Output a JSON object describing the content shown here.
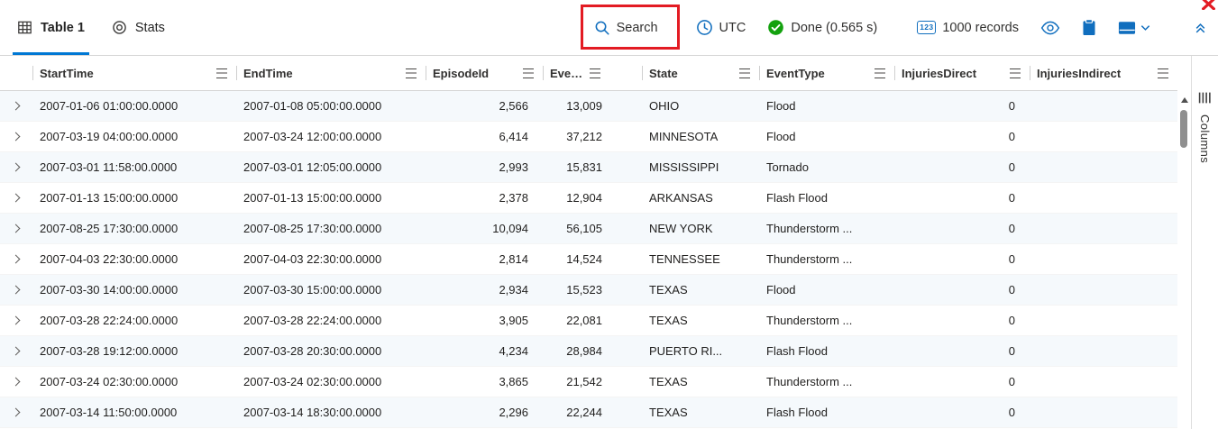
{
  "colors": {
    "accent": "#0078d4",
    "success_green": "#13a10e",
    "annotation_red": "#e31b23"
  },
  "tabs": {
    "table": "Table 1",
    "stats": "Stats"
  },
  "toolbar": {
    "search_label": "Search",
    "timezone_label": "UTC",
    "status_label": "Done (0.565 s)",
    "records_label": "1000 records",
    "numeric_badge_text": "123"
  },
  "columns_panel": {
    "title": "Columns"
  },
  "grid": {
    "columns": [
      {
        "label": "StartTime",
        "numeric": false
      },
      {
        "label": "EndTime",
        "numeric": false
      },
      {
        "label": "EpisodeId",
        "numeric": true
      },
      {
        "label": "EventId",
        "numeric": true
      },
      {
        "label": "State",
        "numeric": false
      },
      {
        "label": "EventType",
        "numeric": false
      },
      {
        "label": "InjuriesDirect",
        "numeric": true
      },
      {
        "label": "InjuriesIndirect",
        "numeric": true
      }
    ],
    "rows": [
      [
        "2007-01-06 01:00:00.0000",
        "2007-01-08 05:00:00.0000",
        "2,566",
        "13,009",
        "OHIO",
        "Flood",
        "0",
        ""
      ],
      [
        "2007-03-19 04:00:00.0000",
        "2007-03-24 12:00:00.0000",
        "6,414",
        "37,212",
        "MINNESOTA",
        "Flood",
        "0",
        ""
      ],
      [
        "2007-03-01 11:58:00.0000",
        "2007-03-01 12:05:00.0000",
        "2,993",
        "15,831",
        "MISSISSIPPI",
        "Tornado",
        "0",
        ""
      ],
      [
        "2007-01-13 15:00:00.0000",
        "2007-01-13 15:00:00.0000",
        "2,378",
        "12,904",
        "ARKANSAS",
        "Flash Flood",
        "0",
        ""
      ],
      [
        "2007-08-25 17:30:00.0000",
        "2007-08-25 17:30:00.0000",
        "10,094",
        "56,105",
        "NEW YORK",
        "Thunderstorm ...",
        "0",
        ""
      ],
      [
        "2007-04-03 22:30:00.0000",
        "2007-04-03 22:30:00.0000",
        "2,814",
        "14,524",
        "TENNESSEE",
        "Thunderstorm ...",
        "0",
        ""
      ],
      [
        "2007-03-30 14:00:00.0000",
        "2007-03-30 15:00:00.0000",
        "2,934",
        "15,523",
        "TEXAS",
        "Flood",
        "0",
        ""
      ],
      [
        "2007-03-28 22:24:00.0000",
        "2007-03-28 22:24:00.0000",
        "3,905",
        "22,081",
        "TEXAS",
        "Thunderstorm ...",
        "0",
        ""
      ],
      [
        "2007-03-28 19:12:00.0000",
        "2007-03-28 20:30:00.0000",
        "4,234",
        "28,984",
        "PUERTO RI...",
        "Flash Flood",
        "0",
        ""
      ],
      [
        "2007-03-24 02:30:00.0000",
        "2007-03-24 02:30:00.0000",
        "3,865",
        "21,542",
        "TEXAS",
        "Thunderstorm ...",
        "0",
        ""
      ],
      [
        "2007-03-14 11:50:00.0000",
        "2007-03-14 18:30:00.0000",
        "2,296",
        "22,244",
        "TEXAS",
        "Flash Flood",
        "0",
        ""
      ]
    ]
  }
}
